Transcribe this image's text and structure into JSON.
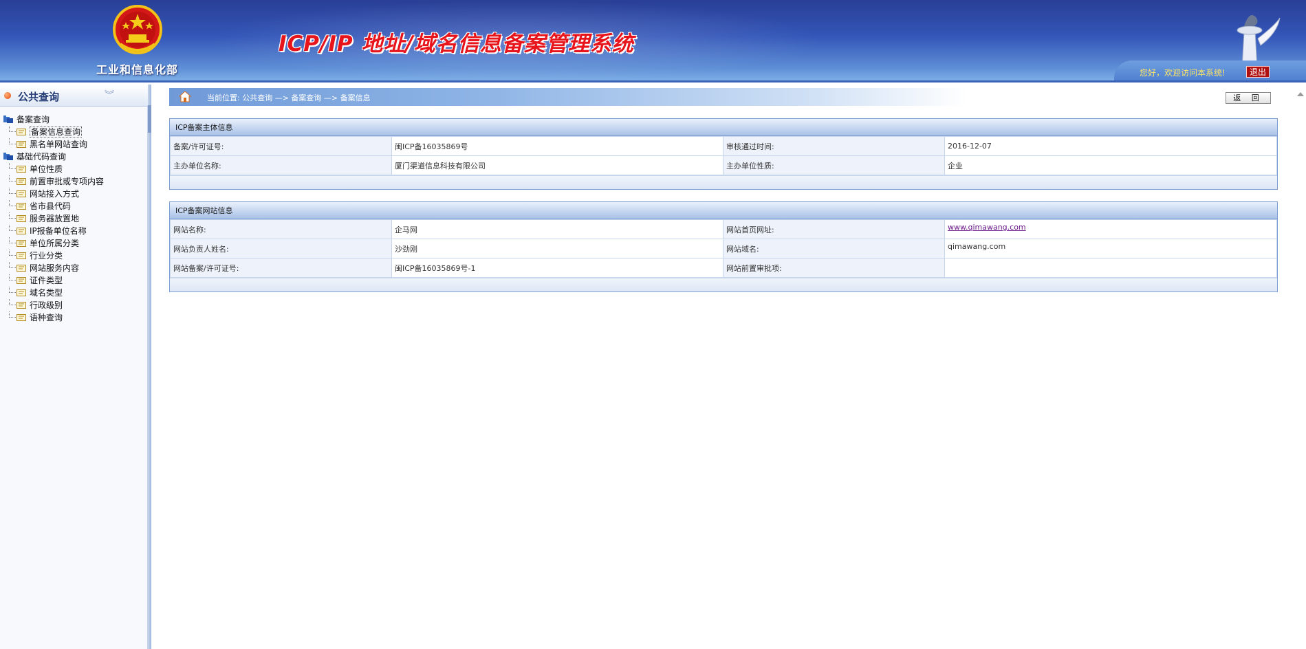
{
  "header": {
    "ministry": "工业和信息化部",
    "system_title": "ICP/IP 地址/域名信息备案管理系统",
    "welcome": "您好，欢迎访问本系统!",
    "logout": "退出"
  },
  "sidebar": {
    "title": "公共查询",
    "groups": [
      {
        "label": "备案查询",
        "items": [
          "备案信息查询",
          "黑名单网站查询"
        ]
      },
      {
        "label": "基础代码查询",
        "items": [
          "单位性质",
          "前置审批或专项内容",
          "网站接入方式",
          "省市县代码",
          "服务器放置地",
          "IP报备单位名称",
          "单位所属分类",
          "行业分类",
          "网站服务内容",
          "证件类型",
          "域名类型",
          "行政级别",
          "语种查询"
        ]
      }
    ]
  },
  "breadcrumb": {
    "text": "当前位置: 公共查询  —>  备案查询  —>  备案信息",
    "back": "返 回"
  },
  "subject_panel": {
    "title": "ICP备案主体信息",
    "rows": [
      [
        "备案/许可证号:",
        "闽ICP备16035869号",
        "审核通过时间:",
        "2016-12-07"
      ],
      [
        "主办单位名称:",
        "厦门渠道信息科技有限公司",
        "主办单位性质:",
        "企业"
      ]
    ]
  },
  "site_panel": {
    "title": "ICP备案网站信息",
    "rows": [
      [
        "网站名称:",
        "企马网",
        "网站首页网址:",
        "www.qimawang.com"
      ],
      [
        "网站负责人姓名:",
        "沙劲刚",
        "网站域名:",
        "qimawang.com"
      ],
      [
        "网站备案/许可证号:",
        "闽ICP备16035869号-1",
        "网站前置审批项:",
        ""
      ]
    ]
  },
  "colors": {
    "header_blue": "#3356b8",
    "title_red": "#e8141c",
    "link_purple": "#6a1a8a"
  }
}
